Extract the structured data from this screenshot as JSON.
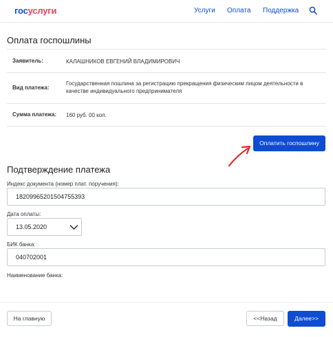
{
  "header": {
    "logo_part1": "гос",
    "logo_part2": "услуги",
    "nav": [
      "Услуги",
      "Оплата",
      "Поддержка"
    ],
    "search_icon": "search-icon"
  },
  "payment": {
    "title": "Оплата госпошлины",
    "rows": [
      {
        "label": "Заявитель:",
        "value": "КАЛАШНИКОВ ЕВГЕНИЙ ВЛАДИМИРОВИЧ"
      },
      {
        "label": "Вид платежа:",
        "value": "Государственная пошлина за регистрацию прекращения физическим лицом деятельности в качестве индивидуального предпринимателя"
      },
      {
        "label": "Сумма платежа:",
        "value": "160 руб. 00 коп."
      }
    ],
    "pay_button": "Оплатить госпошлину",
    "annotation_color": "#e32b2b"
  },
  "confirmation": {
    "title": "Подтверждение платежа",
    "doc_index_label": "Индекс документа (номер плат. поручения):",
    "doc_index_value": "18209965201504755393",
    "date_label": "Дата оплаты:",
    "date_value": "13.05.2020",
    "bik_label": "БИК банка:",
    "bik_value": "040702001",
    "bank_name_label": "Наименование банка:"
  },
  "footer": {
    "home_button": "На главную",
    "back_button": "<<Назад",
    "next_button": "Далее>>"
  },
  "colors": {
    "brand_blue": "#0d4cd3",
    "brand_red": "#ee3f58"
  }
}
